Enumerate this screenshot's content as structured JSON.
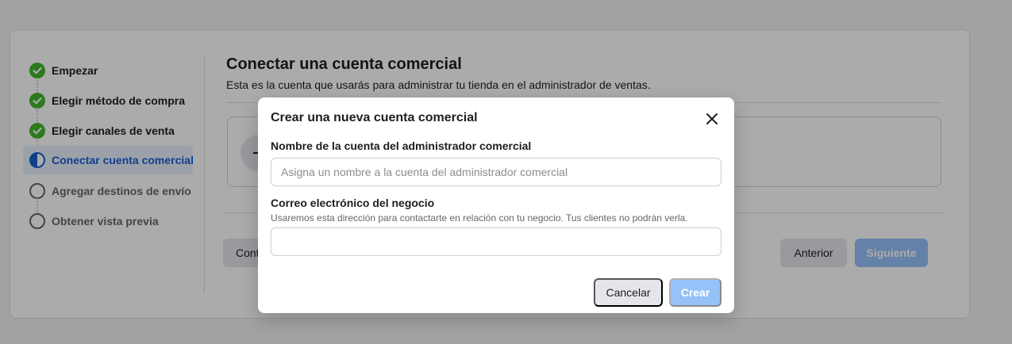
{
  "steps": [
    {
      "label": "Empezar",
      "status": "done"
    },
    {
      "label": "Elegir método de compra",
      "status": "done"
    },
    {
      "label": "Elegir canales de venta",
      "status": "done"
    },
    {
      "label": "Conectar cuenta comercial",
      "status": "active"
    },
    {
      "label": "Agregar destinos de envío",
      "status": "todo"
    },
    {
      "label": "Obtener vista previa",
      "status": "todo"
    }
  ],
  "main": {
    "title": "Conectar una cuenta comercial",
    "subtitle": "Esta es la cuenta que usarás para administrar tu tienda en el administrador de ventas."
  },
  "footer": {
    "continue_label": "Cont",
    "prev_label": "Anterior",
    "next_label": "Siguiente"
  },
  "modal": {
    "title": "Crear una nueva cuenta comercial",
    "name_label": "Nombre de la cuenta del administrador comercial",
    "name_placeholder": "Asigna un nombre a la cuenta del administrador comercial",
    "name_value": "",
    "email_label": "Correo electrónico del negocio",
    "email_help": "Usaremos esta dirección para contactarte en relación con tu negocio. Tus clientes no podrán verla.",
    "email_value": "",
    "cancel_label": "Cancelar",
    "create_label": "Crear"
  },
  "colors": {
    "success": "#42b72a",
    "primary": "#1877f2",
    "active_text": "#1b5fd1"
  },
  "icons": {
    "done": "check-circle-icon",
    "active": "half-circle-icon",
    "todo": "empty-circle-icon",
    "close": "close-icon"
  }
}
